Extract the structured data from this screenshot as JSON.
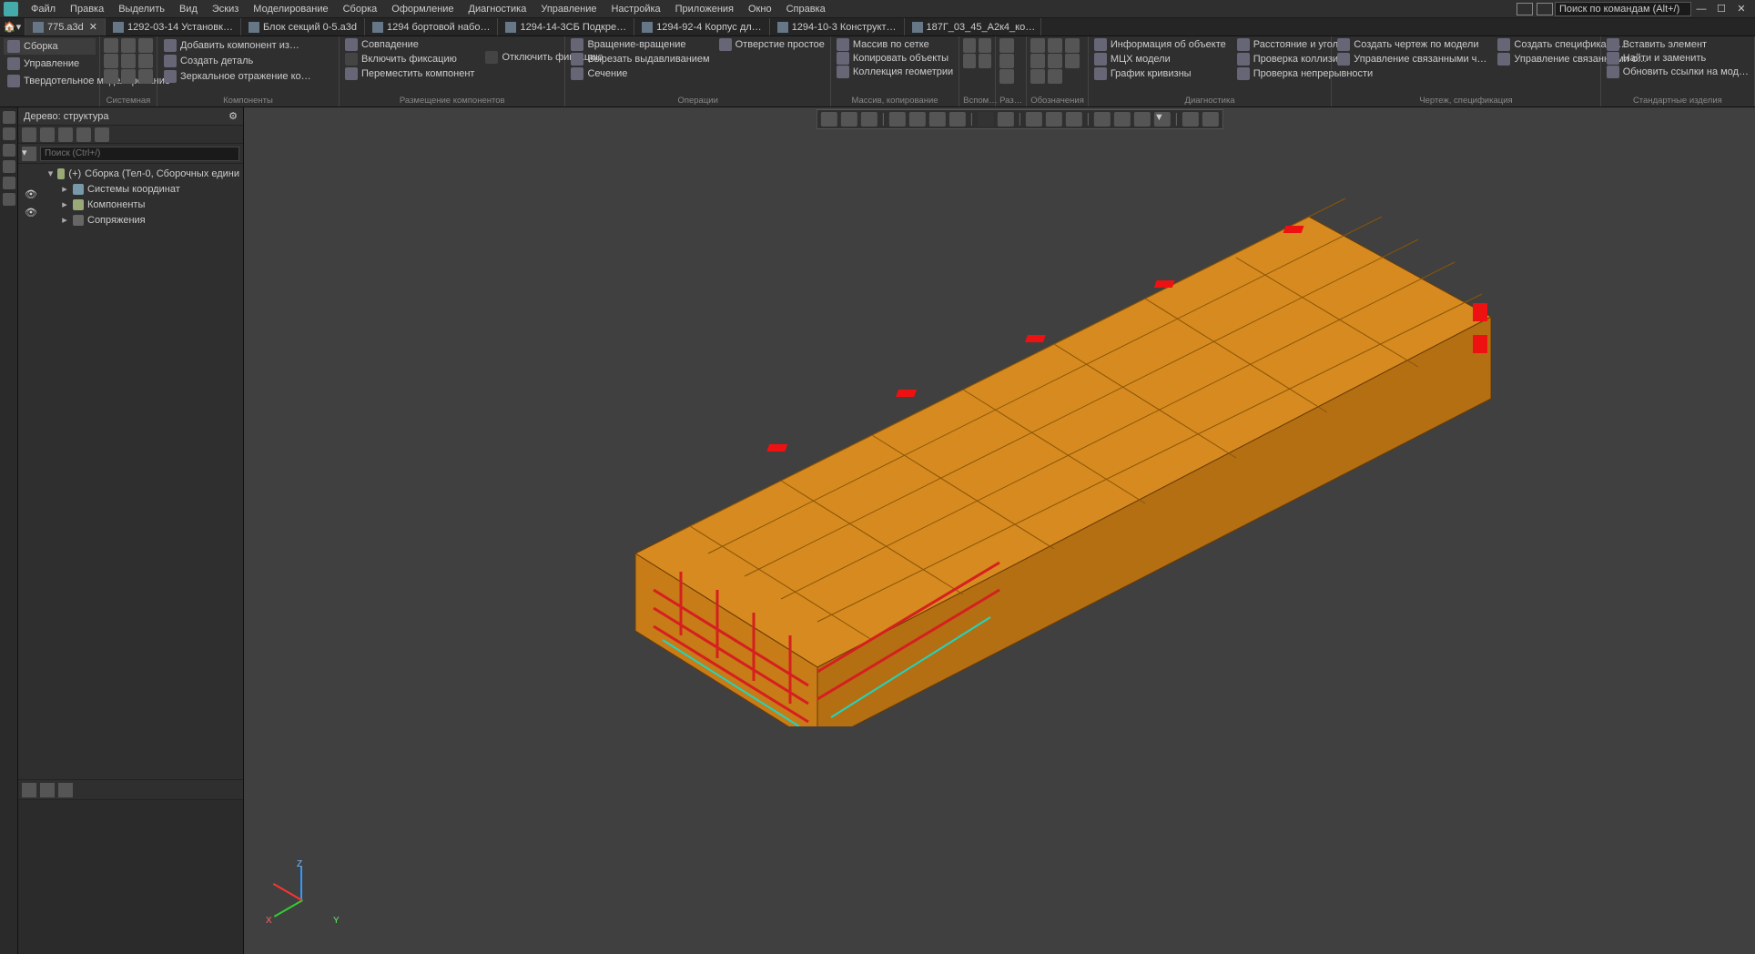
{
  "menu": {
    "items": [
      "Файл",
      "Правка",
      "Выделить",
      "Вид",
      "Эскиз",
      "Моделирование",
      "Сборка",
      "Оформление",
      "Диагностика",
      "Управление",
      "Настройка",
      "Приложения",
      "Окно",
      "Справка"
    ],
    "search_placeholder": "Поиск по командам (Alt+/)"
  },
  "tabs": [
    {
      "label": "775.a3d",
      "active": true,
      "closeable": true
    },
    {
      "label": "1292-03-14 Установк…",
      "active": false
    },
    {
      "label": "Блок секций 0-5.a3d",
      "active": false
    },
    {
      "label": "1294 бортовой набо…",
      "active": false
    },
    {
      "label": "1294-14-3СБ Подкре…",
      "active": false
    },
    {
      "label": "1294-92-4 Корпус дл…",
      "active": false
    },
    {
      "label": "1294-10-3 Конструкт…",
      "active": false
    },
    {
      "label": "187Г_03_45_А2к4_ко…",
      "active": false
    }
  ],
  "ribbon": {
    "context": {
      "items": [
        "Сборка",
        "Управление",
        "Твердотельное моделирование"
      ],
      "active": 0
    },
    "groups": [
      {
        "label": "Системная"
      },
      {
        "label": "Компоненты",
        "buttons": [
          "Добавить компонент из…",
          "Создать деталь",
          "Зеркальное отражение ко…",
          "Совпадение",
          "Включить фиксацию",
          "Отключить фиксацию",
          "Переместить компонент"
        ]
      },
      {
        "label": "Размещение компонентов"
      },
      {
        "label": "Операции",
        "buttons": [
          "Вращение-вращение",
          "Вырезать выдавливанием",
          "Сечение",
          "Отверстие простое"
        ]
      },
      {
        "label": "Массив, копирование",
        "buttons": [
          "Массив по сетке",
          "Копировать объекты",
          "Коллекция геометрии"
        ]
      },
      {
        "label": "Вспом…"
      },
      {
        "label": "Раз…"
      },
      {
        "label": "Обозначения"
      },
      {
        "label": "Диагностика",
        "buttons": [
          "Информация об объекте",
          "МЦХ модели",
          "График кривизны",
          "Расстояние и угол",
          "Проверка коллизий",
          "Проверка непрерывности"
        ]
      },
      {
        "label": "Чертеж, спецификация",
        "buttons": [
          "Создать чертеж по модели",
          "Управление связанными ч…",
          "Создать спецификаци…",
          "Управление связанными с…"
        ]
      },
      {
        "label": "Стандартные изделия",
        "buttons": [
          "Вставить элемент",
          "Найти и заменить",
          "Обновить ссылки на мод…"
        ]
      }
    ]
  },
  "tree": {
    "title": "Дерево: структура",
    "search_placeholder": "Поиск (Ctrl+/)",
    "root": "Сборка (Тел-0, Сборочных едини",
    "nodes": [
      {
        "label": "Системы координат",
        "visible": true
      },
      {
        "label": "Компоненты",
        "visible": true
      },
      {
        "label": "Сопряжения",
        "visible": false,
        "dim": true
      }
    ]
  },
  "triad": {
    "x": "X",
    "y": "Y",
    "z": "Z"
  }
}
